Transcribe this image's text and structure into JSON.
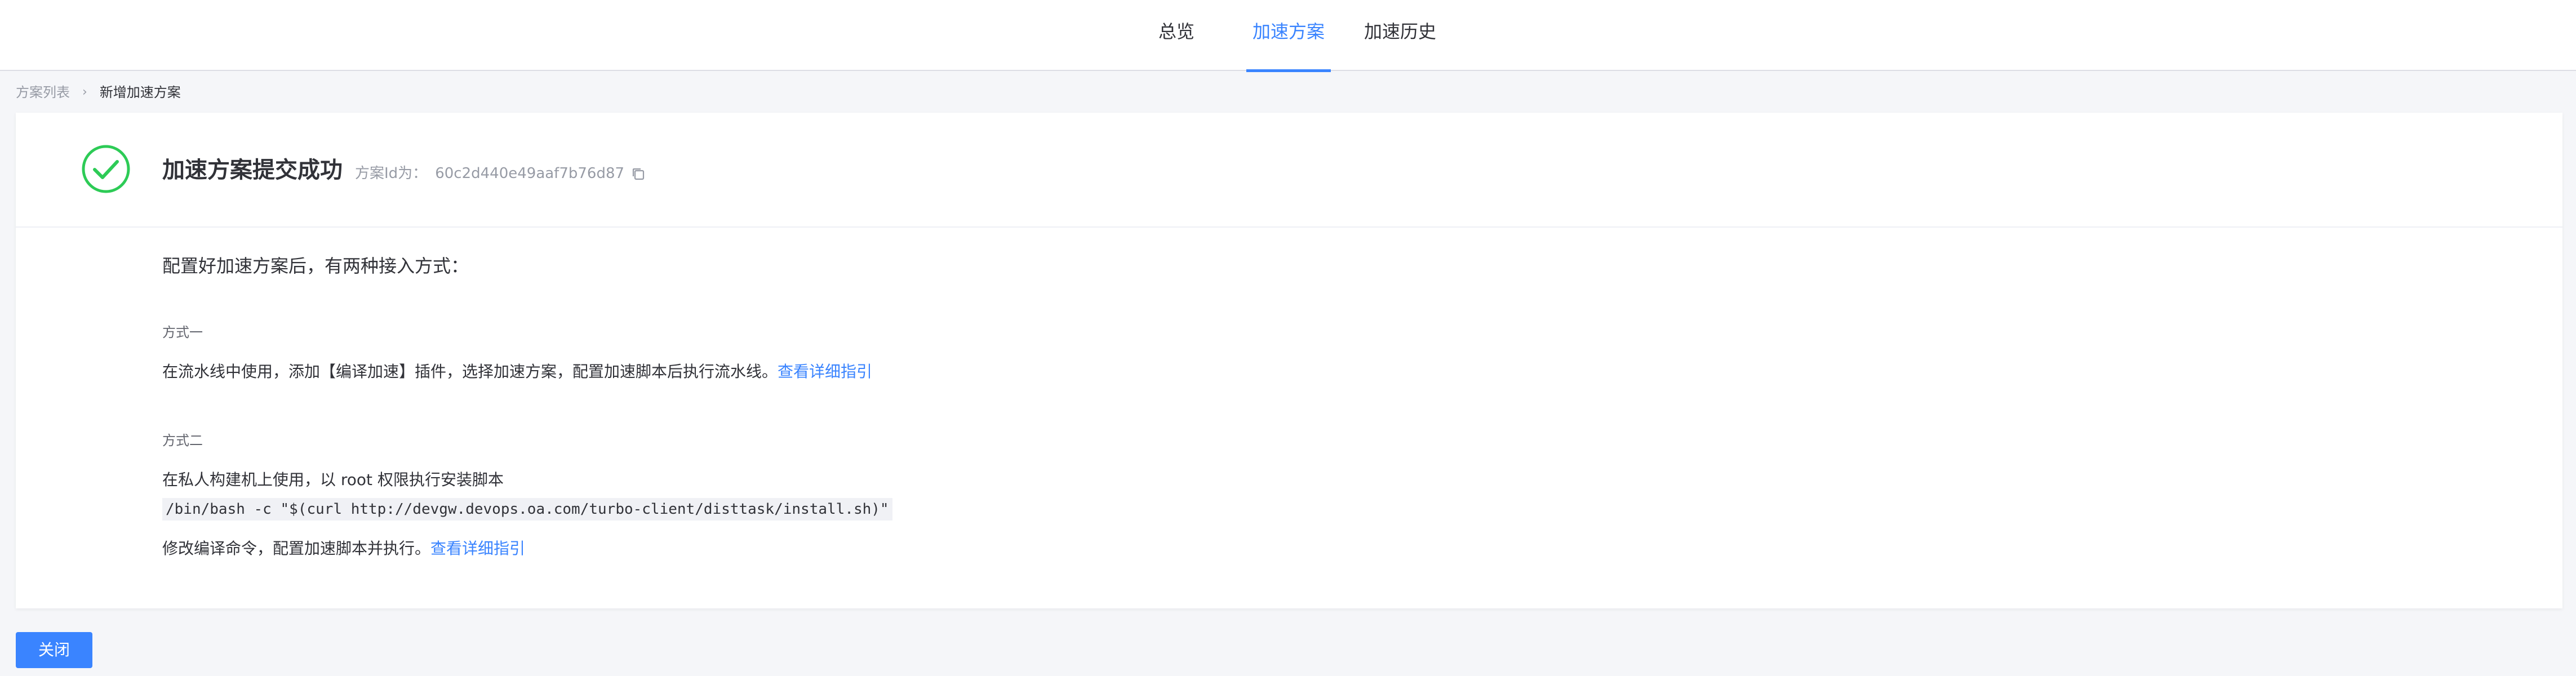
{
  "nav": {
    "tabs": [
      {
        "label": "总览",
        "active": false
      },
      {
        "label": "加速方案",
        "active": true
      },
      {
        "label": "加速历史",
        "active": false
      }
    ]
  },
  "breadcrumb": {
    "parent": "方案列表",
    "separator": "›",
    "current": "新增加速方案"
  },
  "result": {
    "icon": "check-circle-icon",
    "title": "加速方案提交成功",
    "id_label": "方案Id为：",
    "id_value": "60c2d440e49aaf7b76d87"
  },
  "guide": {
    "title": "配置好加速方案后，有两种接入方式：",
    "method1": {
      "label": "方式一",
      "text": "在流水线中使用，添加【编译加速】插件，选择加速方案，配置加速脚本后执行流水线。",
      "link": "查看详细指引"
    },
    "method2": {
      "label": "方式二",
      "text": "在私人构建机上使用，以 root 权限执行安装脚本",
      "command": "/bin/bash -c \"$(curl http://devgw.devops.oa.com/turbo-client/disttask/install.sh)\"",
      "text2": "修改编译命令，配置加速脚本并执行。",
      "link": "查看详细指引"
    }
  },
  "footer": {
    "close_label": "关闭"
  },
  "colors": {
    "accent": "#3a84ff",
    "success": "#2dcb56"
  }
}
